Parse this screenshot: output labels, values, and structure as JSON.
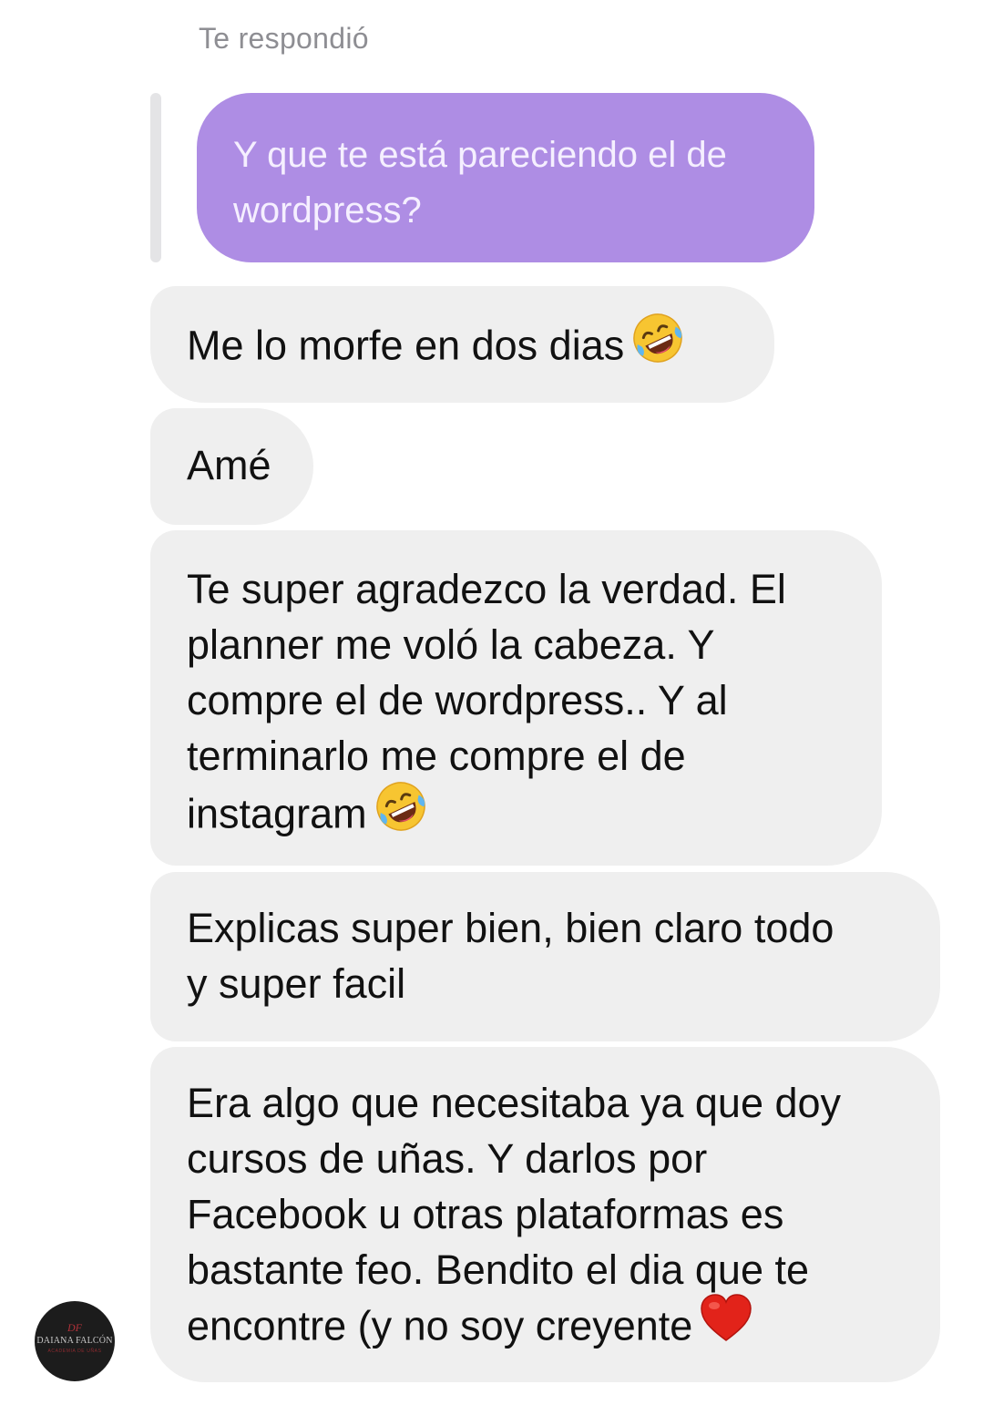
{
  "reply_header": "Te respondió",
  "quoted_message": {
    "line1": "Y que te está pareciendo el de",
    "line2": "wordpress?"
  },
  "messages": [
    {
      "lines": [
        "Me lo morfe en dos dias"
      ],
      "emoji": "rolling-on-floor-laughing-emoji"
    },
    {
      "lines": [
        "Amé"
      ]
    },
    {
      "lines": [
        "Te super agradezco la verdad. El",
        "planner me voló la cabeza. Y",
        "compre el de wordpress.. Y al",
        "terminarlo me compre el de",
        "instagram"
      ],
      "emoji": "rolling-on-floor-laughing-emoji"
    },
    {
      "lines": [
        "Explicas super bien, bien claro todo",
        "y super facil"
      ]
    },
    {
      "lines": [
        "Era algo que necesitaba ya que doy",
        "cursos de uñas. Y darlos por",
        "Facebook u otras plataformas es",
        "bastante feo. Bendito el dia que te",
        "encontre (y no soy creyente"
      ],
      "emoji": "red-heart-emoji"
    }
  ],
  "avatar": {
    "monogram": "DF",
    "name": "DAIANA FALCÓN",
    "subtitle": "ACADEMIA DE UÑAS"
  },
  "colors": {
    "quoted_bubble": "#ae8de4",
    "received_bubble": "#efefef",
    "reply_label": "#8e8e93"
  }
}
